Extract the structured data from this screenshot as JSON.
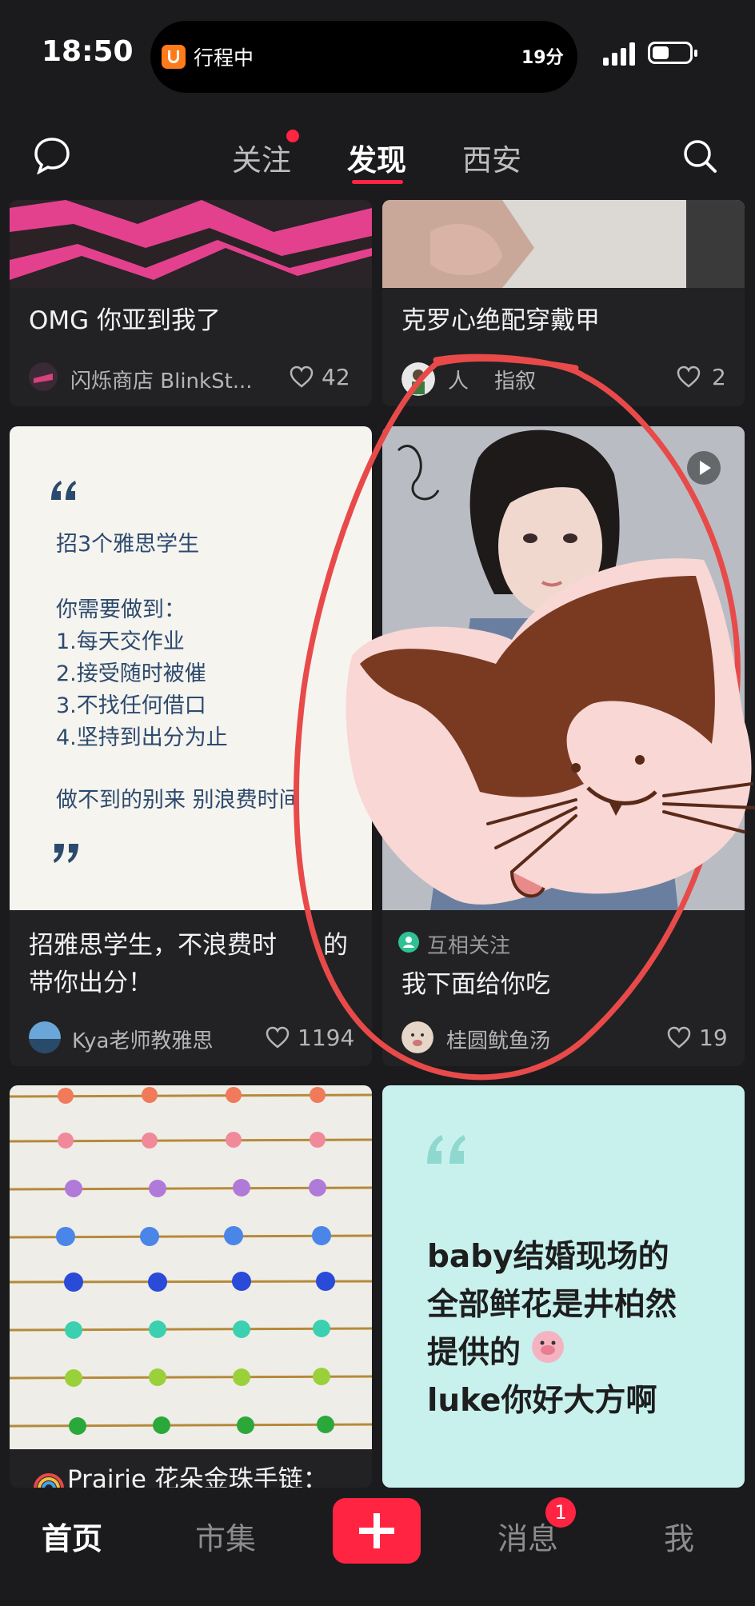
{
  "status": {
    "time": "18:50",
    "island_text": "行程中",
    "island_right": "19分"
  },
  "nav": {
    "tabs": [
      "关注",
      "发现",
      "西安"
    ]
  },
  "cards": [
    {
      "title": "OMG 你亚到我了",
      "author": "闪烁商店 BlinkSt...",
      "likes": "42"
    },
    {
      "title": "克罗心绝配穿戴甲",
      "author": "人",
      "author_tail": "指叙",
      "likes": "2"
    },
    {
      "image_lines": [
        "招3个雅思学生",
        "你需要做到：",
        "1.每天交作业",
        "2.接受随时被催",
        "3.不找任何借口",
        "4.坚持到出分为止",
        "做不到的别来 别浪费时间"
      ],
      "title_line1": "招雅思学生，不浪费时",
      "title_line1_tail": "的",
      "title_line2": "带你出分！",
      "author": "Kya老师教雅思",
      "likes": "1194"
    },
    {
      "tag": "互相关注",
      "title": "我下面给你吃",
      "author": "桂圆鱿鱼汤",
      "likes": "19"
    },
    {
      "title": "Prairie 花朵金珠手链："
    },
    {
      "image_lines": [
        "baby结婚现场的",
        "全部鲜花是井柏然",
        "提供的",
        "luke你好大方啊"
      ]
    }
  ],
  "bottom": {
    "tabs": [
      "首页",
      "市集",
      "消息",
      "我"
    ],
    "badge": "1"
  },
  "colors": {
    "accent": "#ff2442",
    "background": "#1b1b1d",
    "card": "#222224",
    "annotation": "#e84a4a"
  }
}
